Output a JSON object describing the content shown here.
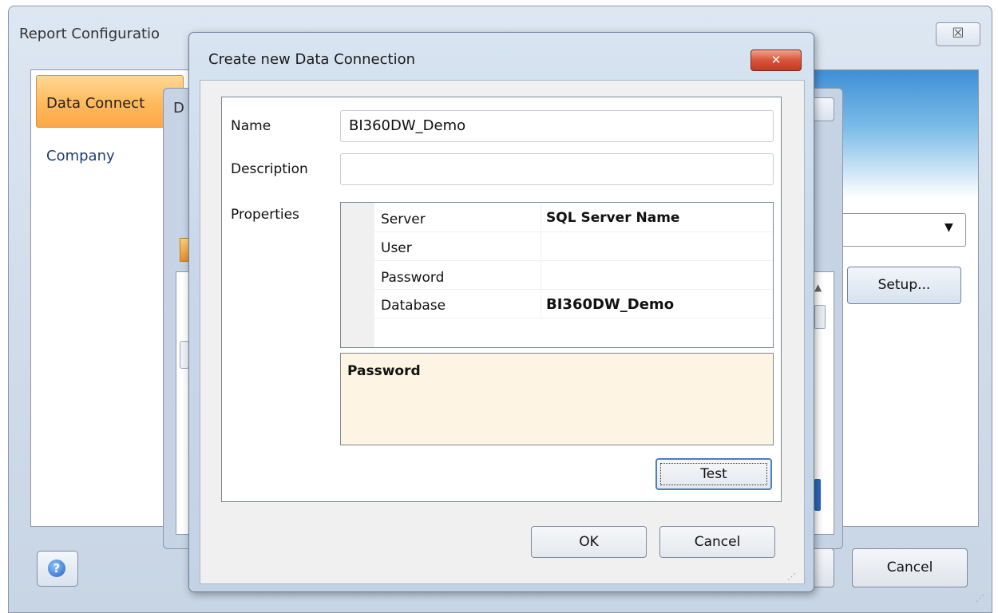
{
  "background_window": {
    "title": "Report Configuratio",
    "close_glyph": "☒",
    "sidebar": [
      {
        "label": "Data Connect",
        "active": true
      },
      {
        "label": "Company",
        "active": false
      }
    ],
    "setup_label": "Setup...",
    "cancel_label": "Cancel",
    "help_glyph": "?",
    "dropdown_arrow": "▼"
  },
  "middle_window": {
    "title": "D"
  },
  "dialog": {
    "title": "Create new Data Connection",
    "close_glyph": "✕",
    "labels": {
      "name": "Name",
      "description": "Description",
      "properties": "Properties"
    },
    "name_value": "BI360DW_Demo",
    "description_value": "",
    "properties": [
      {
        "key": "Server",
        "value": "SQL Server Name"
      },
      {
        "key": "User",
        "value": ""
      },
      {
        "key": "Password",
        "value": ""
      },
      {
        "key": "Database",
        "value": "BI360DW_Demo"
      }
    ],
    "property_description_title": "Password",
    "test_label": "Test",
    "ok_label": "OK",
    "cancel_label": "Cancel"
  },
  "colors": {
    "active_sidebar": "#ffb95c",
    "close_button": "#d8553b",
    "description_panel": "#fdf4e3",
    "focus_border": "#4a7fc0"
  },
  "icons": {
    "help": "help-icon",
    "dialog_close": "close-icon",
    "window_close": "close-icon",
    "dropdown": "chevron-down-icon",
    "resize": "resize-grip-icon"
  }
}
